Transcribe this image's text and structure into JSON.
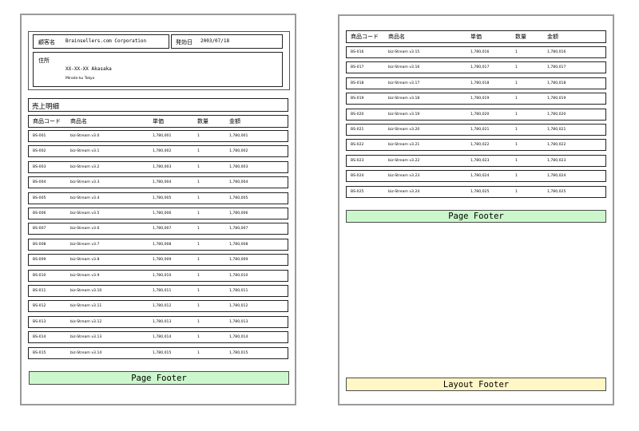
{
  "customer": {
    "name_label": "顧客名",
    "name_value": "Brainsellers.com Corporation",
    "date_label": "発効日",
    "date_value": "2003/07/18",
    "address_label": "住所",
    "address_line1": "XX-XX-XX Akasaka",
    "address_line2": "Minato-ku Tokyo"
  },
  "section_title": "売上明細",
  "columns": [
    "商品コード",
    "商品名",
    "単価",
    "数量",
    "金額"
  ],
  "page1_rows": [
    [
      "BS-001",
      "biz-Stream v3.0",
      "1,780,001",
      "1",
      "1,780,001"
    ],
    [
      "BS-002",
      "biz-Stream v3.1",
      "1,780,002",
      "1",
      "1,780,002"
    ],
    [
      "BS-003",
      "biz-Stream v3.2",
      "1,780,003",
      "1",
      "1,780,003"
    ],
    [
      "BS-004",
      "biz-Stream v3.3",
      "1,780,004",
      "1",
      "1,780,004"
    ],
    [
      "BS-005",
      "biz-Stream v3.4",
      "1,780,005",
      "1",
      "1,780,005"
    ],
    [
      "BS-006",
      "biz-Stream v3.5",
      "1,780,006",
      "1",
      "1,780,006"
    ],
    [
      "BS-007",
      "biz-Stream v3.6",
      "1,780,007",
      "1",
      "1,780,007"
    ],
    [
      "BS-008",
      "biz-Stream v3.7",
      "1,780,008",
      "1",
      "1,780,008"
    ],
    [
      "BS-009",
      "biz-Stream v3.8",
      "1,780,009",
      "1",
      "1,780,009"
    ],
    [
      "BS-010",
      "biz-Stream v3.9",
      "1,780,010",
      "1",
      "1,780,010"
    ],
    [
      "BS-011",
      "biz-Stream v3.10",
      "1,780,011",
      "1",
      "1,780,011"
    ],
    [
      "BS-012",
      "biz-Stream v3.11",
      "1,780,012",
      "1",
      "1,780,012"
    ],
    [
      "BS-013",
      "biz-Stream v3.12",
      "1,780,013",
      "1",
      "1,780,013"
    ],
    [
      "BS-014",
      "biz-Stream v3.13",
      "1,780,014",
      "1",
      "1,780,014"
    ],
    [
      "BS-015",
      "biz-Stream v3.14",
      "1,780,015",
      "1",
      "1,780,015"
    ]
  ],
  "page2_rows": [
    [
      "BS-016",
      "biz-Stream v3.15",
      "1,780,016",
      "1",
      "1,780,016"
    ],
    [
      "BS-017",
      "biz-Stream v3.16",
      "1,780,017",
      "1",
      "1,780,017"
    ],
    [
      "BS-018",
      "biz-Stream v3.17",
      "1,780,018",
      "1",
      "1,780,018"
    ],
    [
      "BS-019",
      "biz-Stream v3.18",
      "1,780,019",
      "1",
      "1,780,019"
    ],
    [
      "BS-020",
      "biz-Stream v3.19",
      "1,780,020",
      "1",
      "1,780,020"
    ],
    [
      "BS-021",
      "biz-Stream v3.20",
      "1,780,021",
      "1",
      "1,780,021"
    ],
    [
      "BS-022",
      "biz-Stream v3.21",
      "1,780,022",
      "1",
      "1,780,022"
    ],
    [
      "BS-023",
      "biz-Stream v3.22",
      "1,780,023",
      "1",
      "1,780,023"
    ],
    [
      "BS-024",
      "biz-Stream v3.23",
      "1,780,024",
      "1",
      "1,780,024"
    ],
    [
      "BS-025",
      "biz-Stream v3.24",
      "1,780,025",
      "1",
      "1,780,025"
    ]
  ],
  "page_footer": "Page Footer",
  "layout_footer": "Layout Footer",
  "colors": {
    "page_footer_bg": "#ccf7cc",
    "layout_footer_bg": "#fff7c6",
    "page_border": "#9a9a9a"
  }
}
